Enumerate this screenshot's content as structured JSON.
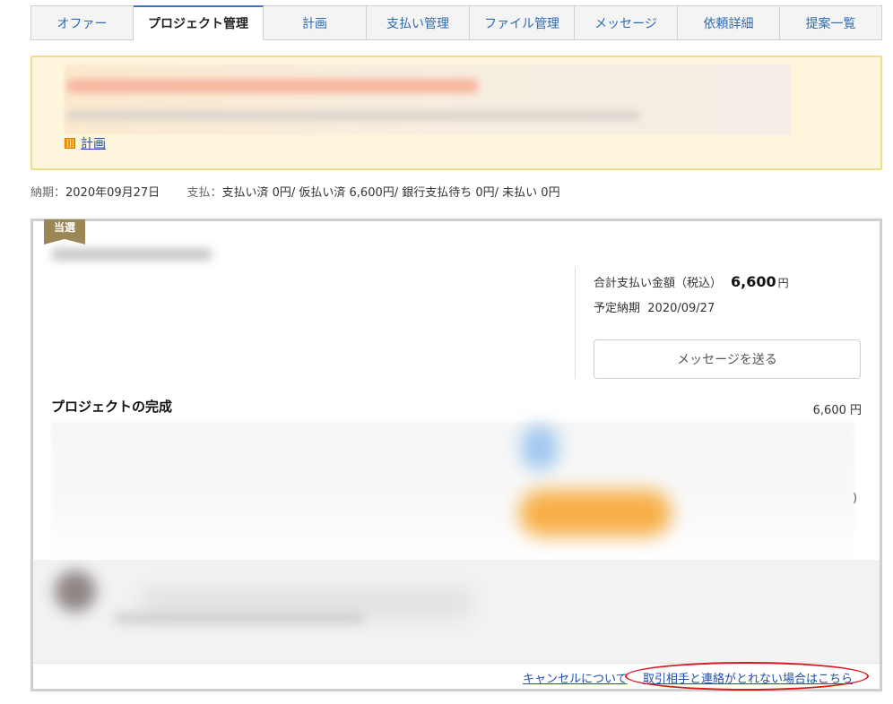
{
  "tabs": [
    {
      "label": "オファー",
      "active": false
    },
    {
      "label": "プロジェクト管理",
      "active": true
    },
    {
      "label": "計画",
      "active": false
    },
    {
      "label": "支払い管理",
      "active": false
    },
    {
      "label": "ファイル管理",
      "active": false
    },
    {
      "label": "メッセージ",
      "active": false
    },
    {
      "label": "依頼詳細",
      "active": false
    },
    {
      "label": "提案一覧",
      "active": false
    }
  ],
  "notice": {
    "link_label": "計画"
  },
  "summary": {
    "due_label": "納期：",
    "due_value": "2020年09月27日",
    "payment_label": "支払：",
    "payment_value": "支払い済 0円/ 仮払い済 6,600円/ 銀行支払待ち 0円/ 未払い 0円"
  },
  "panel": {
    "badge": "当選",
    "total_label": "合計支払い金額（税込）",
    "total_amount": "6,600",
    "total_unit": "円",
    "due_label": "予定納期",
    "due_value": "2020/09/27",
    "message_button": "メッセージを送る",
    "project_title": "プロジェクトの完成",
    "project_amount": "6,600 円",
    "paren": ")"
  },
  "footer": {
    "cancel_link": "キャンセルについて",
    "contact_link": "取引相手と連絡がとれない場合はこちら"
  },
  "colors": {
    "tab_text": "#2f6bb3",
    "notice_bg": "#fdf6dc",
    "notice_border": "#f0dc8a",
    "badge": "#9b8655",
    "link": "#1f4ea8",
    "highlight": "#d8191f"
  }
}
